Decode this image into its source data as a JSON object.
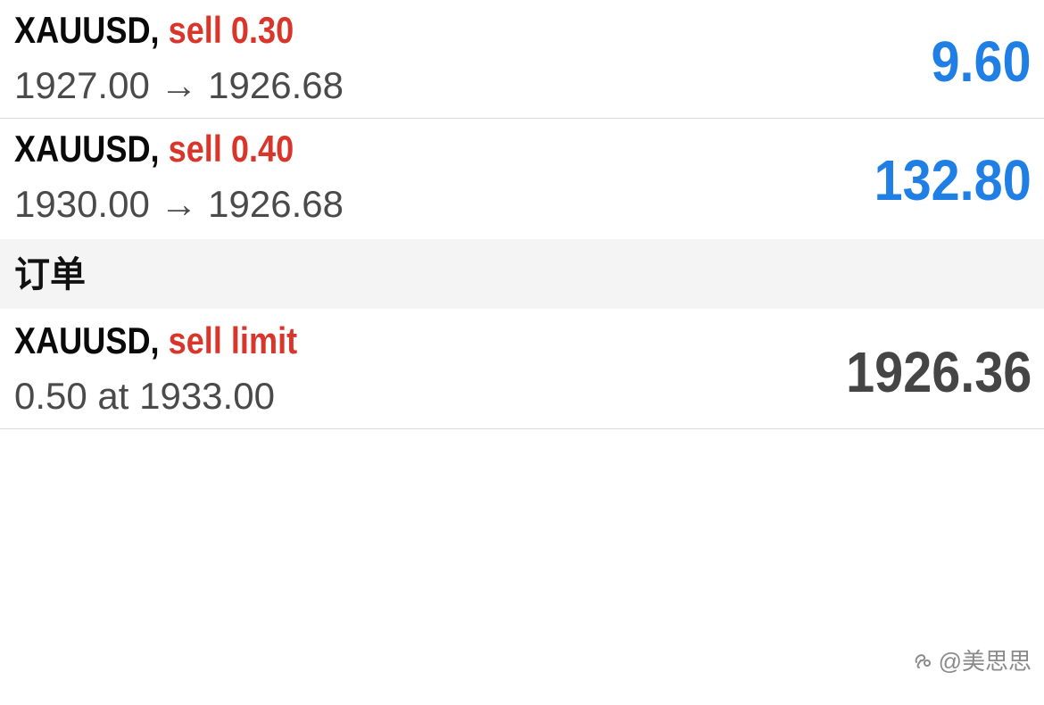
{
  "positions": [
    {
      "symbol": "XAUUSD",
      "separator": ",",
      "side": "sell 0.30",
      "open_price": "1927.00",
      "arrow": "→",
      "current_price": "1926.68",
      "profit": "9.60"
    },
    {
      "symbol": "XAUUSD",
      "separator": ",",
      "side": "sell 0.40",
      "open_price": "1930.00",
      "arrow": "→",
      "current_price": "1926.68",
      "profit": "132.80"
    }
  ],
  "orders_section": {
    "title": "订单"
  },
  "orders": [
    {
      "symbol": "XAUUSD",
      "separator": ",",
      "side": "sell limit",
      "details": "0.50 at 1933.00",
      "price": "1926.36"
    }
  ],
  "watermark": {
    "text": "@美思思",
    "icon": "weibo-style-logo-icon"
  },
  "colors": {
    "sell": "#d9362b",
    "profit": "#1f7fe4",
    "price": "#454545",
    "section_bg": "#f4f4f4"
  }
}
